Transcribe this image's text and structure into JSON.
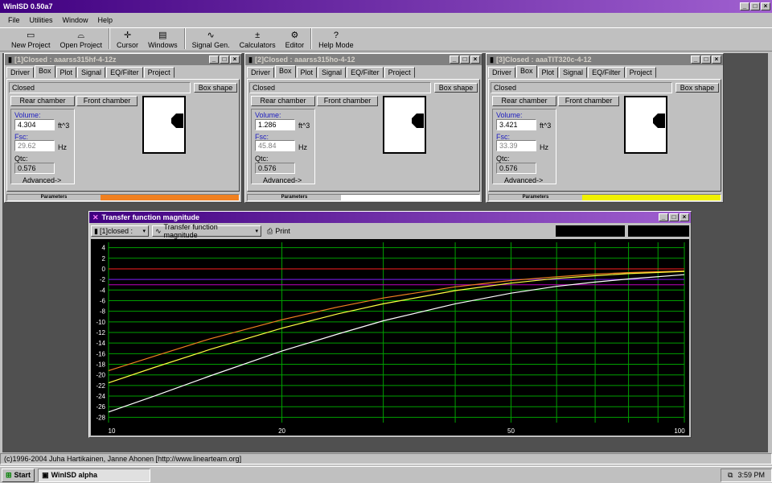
{
  "app": {
    "title": "WinISD 0.50a7"
  },
  "menu": [
    "File",
    "Utilities",
    "Window",
    "Help"
  ],
  "toolbar": [
    {
      "label": "New Project",
      "icon": "new-project-icon",
      "glyph": "▭"
    },
    {
      "label": "Open Project",
      "icon": "open-project-icon",
      "glyph": "⌓"
    },
    {
      "label": "Cursor",
      "icon": "cursor-icon",
      "glyph": "✛"
    },
    {
      "label": "Windows",
      "icon": "windows-icon",
      "glyph": "▤"
    },
    {
      "label": "Signal Gen.",
      "icon": "signal-gen-icon",
      "glyph": "∿"
    },
    {
      "label": "Calculators",
      "icon": "calculators-icon",
      "glyph": "±"
    },
    {
      "label": "Editor",
      "icon": "editor-icon",
      "glyph": "⚙"
    },
    {
      "label": "Help Mode",
      "icon": "help-icon",
      "glyph": "?"
    }
  ],
  "projects": [
    {
      "title": "[1]Closed : aaarss315hf-4-12z",
      "tabs": [
        "Driver",
        "Box",
        "Plot",
        "Signal",
        "EQ/Filter",
        "Project"
      ],
      "box_type": "Closed",
      "box_shape_label": "Box shape",
      "rear_label": "Rear chamber",
      "front_label": "Front chamber",
      "volume_label": "Volume:",
      "volume": "4.304",
      "volume_unit": "ft^3",
      "fsc_label": "Fsc:",
      "fsc": "29.62",
      "fsc_unit": "Hz",
      "qtc_label": "Qtc:",
      "qtc": "0.576",
      "advanced_label": "Advanced->",
      "params_label": "Parameters",
      "color": "#f08020"
    },
    {
      "title": "[2]Closed : aaarss315ho-4-12",
      "tabs": [
        "Driver",
        "Box",
        "Plot",
        "Signal",
        "EQ/Filter",
        "Project"
      ],
      "box_type": "Closed",
      "box_shape_label": "Box shape",
      "rear_label": "Rear chamber",
      "front_label": "Front chamber",
      "volume_label": "Volume:",
      "volume": "1.286",
      "volume_unit": "ft^3",
      "fsc_label": "Fsc:",
      "fsc": "45.84",
      "fsc_unit": "Hz",
      "qtc_label": "Qtc:",
      "qtc": "0.576",
      "advanced_label": "Advanced->",
      "params_label": "Parameters",
      "color": "#ffffff"
    },
    {
      "title": "[3]Closed : aaaTIT320c-4-12",
      "tabs": [
        "Driver",
        "Box",
        "Plot",
        "Signal",
        "EQ/Filter",
        "Project"
      ],
      "box_type": "Closed",
      "box_shape_label": "Box shape",
      "rear_label": "Rear chamber",
      "front_label": "Front chamber",
      "volume_label": "Volume:",
      "volume": "3.421",
      "volume_unit": "ft^3",
      "fsc_label": "Fsc:",
      "fsc": "33.39",
      "fsc_unit": "Hz",
      "qtc_label": "Qtc:",
      "qtc": "0.576",
      "advanced_label": "Advanced->",
      "params_label": "Parameters",
      "color": "#f0f000"
    }
  ],
  "graph": {
    "title": "Transfer function magnitude",
    "project_select": "[1]closed :",
    "plot_select": "Transfer function magnitude",
    "print_label": "Print"
  },
  "chart_data": {
    "type": "line",
    "xscale": "log",
    "xlim": [
      10,
      100
    ],
    "ylim": [
      -29,
      5
    ],
    "x_ticks": [
      10,
      20,
      50,
      100
    ],
    "y_ticks": [
      4,
      2,
      0,
      -2,
      -4,
      -6,
      -8,
      -10,
      -12,
      -14,
      -16,
      -18,
      -20,
      -22,
      -24,
      -26,
      -28
    ],
    "grid": true,
    "hlines": [
      {
        "y": 0,
        "color": "#ff2020"
      },
      {
        "y": -3,
        "color": "#c000c0"
      },
      {
        "y": -2,
        "color": "#8000ff"
      }
    ],
    "series": [
      {
        "color": "#f08020",
        "x": [
          10,
          12,
          15,
          20,
          25,
          30,
          40,
          50,
          60,
          70,
          80,
          100
        ],
        "y": [
          -19.2,
          -16.5,
          -13.2,
          -9.6,
          -7.2,
          -5.5,
          -3.4,
          -2.2,
          -1.5,
          -1.0,
          -0.7,
          -0.4
        ]
      },
      {
        "color": "#ffff40",
        "x": [
          10,
          12,
          15,
          20,
          25,
          30,
          40,
          50,
          60,
          70,
          80,
          100
        ],
        "y": [
          -21.5,
          -18.6,
          -15.2,
          -11.2,
          -8.5,
          -6.6,
          -4.1,
          -2.7,
          -1.8,
          -1.3,
          -0.9,
          -0.5
        ]
      },
      {
        "color": "#ffffff",
        "x": [
          10,
          12,
          15,
          20,
          25,
          30,
          40,
          50,
          60,
          70,
          80,
          100
        ],
        "y": [
          -27.0,
          -24.0,
          -20.2,
          -15.5,
          -12.3,
          -9.8,
          -6.6,
          -4.6,
          -3.3,
          -2.5,
          -1.9,
          -1.1
        ]
      }
    ]
  },
  "status": "(c)1996-2004 Juha Hartikainen, Janne Ahonen [http://www.linearteam.org]",
  "taskbar": {
    "start": "Start",
    "task": "WinISD alpha",
    "time": "3:59 PM"
  }
}
